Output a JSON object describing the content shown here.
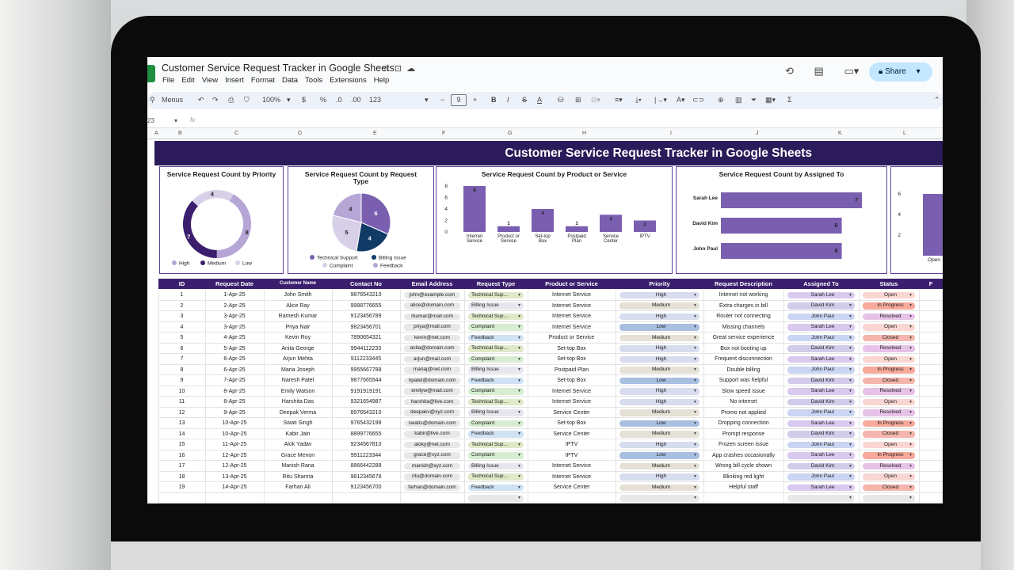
{
  "app": {
    "doc_title": "Customer Service Request Tracker in Google Sheets",
    "menu": [
      "File",
      "Edit",
      "View",
      "Insert",
      "Format",
      "Data",
      "Tools",
      "Extensions",
      "Help"
    ],
    "share_label": "Share",
    "toolbar": {
      "search": "Menus",
      "zoom": "100%",
      "currency": "$",
      "percent": "%",
      "dec_less": ".0",
      "dec_more": ".00",
      "number_format": "123",
      "font_size": "9",
      "cell_ref": "23",
      "fx": "fx"
    },
    "columns": [
      "A",
      "B",
      "C",
      "D",
      "E",
      "F",
      "G",
      "H",
      "I",
      "J",
      "K",
      "L"
    ]
  },
  "dashboard": {
    "title": "Customer Service Request Tracker in Google Sheets",
    "cards": {
      "priority": {
        "title": "Service Request Count by Priority"
      },
      "request_type": {
        "title_line1": "Service Request Count by Request",
        "title_line2": "Type"
      },
      "product": {
        "title": "Service Request Count by Product or Service"
      },
      "assigned": {
        "title": "Service Request Count by Assigned To"
      }
    },
    "colors": {
      "dark_purple": "#3b1f6e",
      "mid_purple": "#7a5fb0",
      "light_purple": "#b6a6d6",
      "navy": "#123a66",
      "pale": "#d8cfe8"
    }
  },
  "chart_data": [
    {
      "type": "pie",
      "variant": "donut",
      "categories": [
        "High",
        "Medium",
        "Low"
      ],
      "values": [
        8,
        7,
        4
      ],
      "legend": "bottom"
    },
    {
      "type": "pie",
      "categories": [
        "Technical Support",
        "Billing Issue",
        "Complaint",
        "Feedback"
      ],
      "values": [
        6,
        4,
        5,
        4
      ],
      "legend": "bottom"
    },
    {
      "type": "bar",
      "categories": [
        "Internet Service",
        "Product or Service",
        "Set-top Box",
        "Postpaid Plan",
        "Service Center",
        "IPTV"
      ],
      "values": [
        8,
        1,
        4,
        1,
        3,
        2
      ],
      "ylim": [
        0,
        8
      ],
      "yticks": [
        0,
        2,
        4,
        6,
        8
      ]
    },
    {
      "type": "bar",
      "orientation": "horizontal",
      "categories": [
        "Sarah Lee",
        "David Kim",
        "John Paul"
      ],
      "values": [
        7,
        6,
        6
      ]
    },
    {
      "type": "bar",
      "categories": [
        "Open"
      ],
      "values": [
        6
      ],
      "yticks": [
        2,
        4,
        6
      ]
    }
  ],
  "table": {
    "headers": [
      "ID",
      "Request Date",
      "Customer Name",
      "Contact No",
      "Email Address",
      "Request Type",
      "Product or Service",
      "Priority",
      "Request Description",
      "Assigned To",
      "Status",
      "F"
    ],
    "rows": [
      [
        "1",
        "1-Apr-25",
        "John Smith",
        "9876543210",
        "john@example.com",
        "Technical Sup...",
        "Internet Service",
        "High",
        "Internet not working",
        "Sarah Lee",
        "Open"
      ],
      [
        "2",
        "2-Apr-25",
        "Alice Ray",
        "9988776655",
        "alice@domain.com",
        "Billing Issue",
        "Internet Service",
        "Medium",
        "Extra charges in bill",
        "David Kim",
        "In Progress"
      ],
      [
        "3",
        "3-Apr-25",
        "Ramesh Kumar",
        "9123456789",
        "rkumar@mail.com",
        "Technical Sup...",
        "Internet Service",
        "High",
        "Router not connecting",
        "John Paul",
        "Resolved"
      ],
      [
        "4",
        "3-Apr-25",
        "Priya Nair",
        "9823456701",
        "priya@mail.com",
        "Complaint",
        "Internet Service",
        "Low",
        "Missing channels",
        "Sarah Lee",
        "Open"
      ],
      [
        "5",
        "4-Apr-25",
        "Kevin Roy",
        "7890654321",
        "kevin@net.com",
        "Feedback",
        "Product or Service",
        "Medium",
        "Great service experience",
        "John Paul",
        "Closed"
      ],
      [
        "6",
        "5-Apr-25",
        "Anita George",
        "9944112233",
        "anita@domain.com",
        "Technical Sup...",
        "Set-top Box",
        "High",
        "Box not booting up",
        "David Kim",
        "Resolved"
      ],
      [
        "7",
        "6-Apr-25",
        "Arjun Mehta",
        "9112233445",
        "arjun@mail.com",
        "Complaint",
        "Set-top Box",
        "High",
        "Frequent disconnection",
        "Sarah Lee",
        "Open"
      ],
      [
        "8",
        "6-Apr-25",
        "Maria Joseph",
        "9955667788",
        "mariaj@net.com",
        "Billing Issue",
        "Postpaid Plan",
        "Medium",
        "Double billing",
        "John Paul",
        "In Progress"
      ],
      [
        "9",
        "7-Apr-25",
        "Naresh Patel",
        "9877665544",
        "npatel@domain.com",
        "Feedback",
        "Set-top Box",
        "Low",
        "Support was helpful",
        "David Kim",
        "Closed"
      ],
      [
        "10",
        "8-Apr-25",
        "Emily Watson",
        "9191919191",
        "emilyw@mail.com",
        "Complaint",
        "Internet Service",
        "High",
        "Slow speed issue",
        "Sarah Lee",
        "Resolved"
      ],
      [
        "11",
        "8-Apr-25",
        "Harshita Das",
        "9321654987",
        "harshita@live.com",
        "Technical Sup...",
        "Internet Service",
        "High",
        "No internet",
        "David Kim",
        "Open"
      ],
      [
        "12",
        "9-Apr-25",
        "Deepak Verma",
        "8976543210",
        "deepakv@xyz.com",
        "Billing Issue",
        "Service Center",
        "Medium",
        "Promo not applied",
        "John Paul",
        "Resolved"
      ],
      [
        "13",
        "10-Apr-25",
        "Swati Singh",
        "9765432198",
        "swatis@domain.com",
        "Complaint",
        "Set-top Box",
        "Low",
        "Dropping connection",
        "Sarah Lee",
        "In Progress"
      ],
      [
        "14",
        "10-Apr-25",
        "Kabir Jain",
        "8899776655",
        "kabir@live.com",
        "Feedback",
        "Service Center",
        "Medium",
        "Prompt response",
        "David Kim",
        "Closed"
      ],
      [
        "15",
        "11-Apr-25",
        "Alok Yadav",
        "9234567810",
        "aloky@net.com",
        "Technical Sup...",
        "IPTV",
        "High",
        "Frozen screen issue",
        "John Paul",
        "Open"
      ],
      [
        "16",
        "12-Apr-25",
        "Grace Menon",
        "9911223344",
        "grace@xyz.com",
        "Complaint",
        "IPTV",
        "Low",
        "App crashes occasionally",
        "Sarah Lee",
        "In Progress"
      ],
      [
        "17",
        "12-Apr-25",
        "Manish Rana",
        "8866442288",
        "manish@xyz.com",
        "Billing Issue",
        "Internet Service",
        "Medium",
        "Wrong bill cycle shown",
        "David Kim",
        "Resolved"
      ],
      [
        "18",
        "13-Apr-25",
        "Ritu Sharma",
        "9812345678",
        "ritu@domain.com",
        "Technical Sup...",
        "Internet Service",
        "High",
        "Blinking red light",
        "John Paul",
        "Open"
      ],
      [
        "19",
        "14-Apr-25",
        "Farhan Ali",
        "9123456700",
        "farhan@domain.com",
        "Feedback",
        "Service Center",
        "Medium",
        "Helpful staff",
        "Sarah Lee",
        "Closed"
      ]
    ],
    "chip_colors": {
      "Technical Sup...": "#dfe9c8",
      "Billing Issue": "#e6e6ee",
      "Complaint": "#d7ecd1",
      "Feedback": "#cfe2f3",
      "High": "#d7dcef",
      "Medium": "#e6e1d6",
      "Low": "#a9bfe0",
      "Sarah Lee": "#d9c9ef",
      "David Kim": "#d3cbea",
      "John Paul": "#c9d5f2",
      "Open": "#f9d6d1",
      "In Progress": "#f7a99a",
      "Resolved": "#e7c2e8",
      "Closed": "#f5b5ad"
    }
  }
}
